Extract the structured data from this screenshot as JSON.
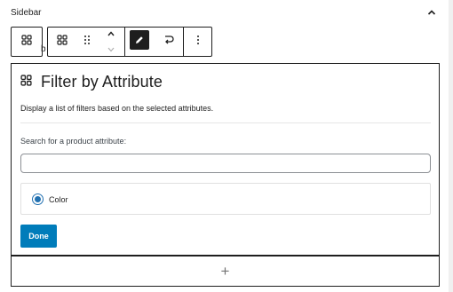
{
  "panel": {
    "title": "Sidebar",
    "toggle_icon": "chevron-up-icon"
  },
  "toolbar": {
    "parent_icon": "block-grid-icon",
    "block_icon": "block-grid-icon",
    "drag_icon": "drag-handle-icon",
    "move_up_icon": "chevron-up-icon",
    "move_down_icon": "chevron-down-icon",
    "edit_icon": "pencil-icon",
    "transform_icon": "loop-arrow-icon",
    "more_icon": "more-vertical-icon",
    "active_color": "#1e1e1e"
  },
  "block": {
    "icon": "block-grid-icon",
    "title": "Filter by Attribute",
    "description": "Display a list of filters based on the selected attributes.",
    "search_label": "Search for a product attribute:",
    "search_value": "",
    "search_placeholder": "",
    "attributes": [
      {
        "label": "Color",
        "selected": true
      }
    ],
    "done_label": "Done",
    "accent_color": "#007cba"
  },
  "appender": {
    "label": "+"
  }
}
